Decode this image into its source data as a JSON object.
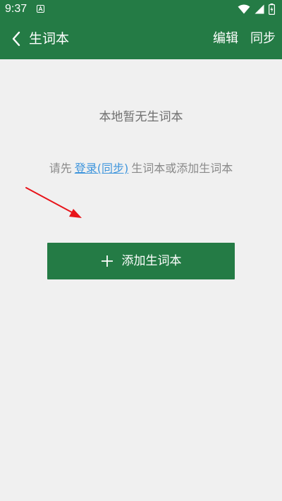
{
  "status_bar": {
    "time": "9:37",
    "icons": [
      "notification-a-icon",
      "wifi-icon",
      "cellular-signal-icon",
      "battery-charging-icon"
    ]
  },
  "app_bar": {
    "title": "生词本",
    "back_icon": "chevron-left-icon",
    "actions": {
      "edit": "编辑",
      "sync": "同步"
    }
  },
  "main": {
    "empty_message": "本地暂无生词本",
    "hint": {
      "prefix": "请先",
      "link": "登录(同步)",
      "suffix": "生词本或添加生词本"
    },
    "add_button": {
      "label": "添加生词本",
      "icon": "plus-icon"
    }
  },
  "colors": {
    "primary": "#247b45",
    "background": "#f0f0f0",
    "link": "#3e95dc",
    "annotation_arrow": "#e8141a"
  }
}
